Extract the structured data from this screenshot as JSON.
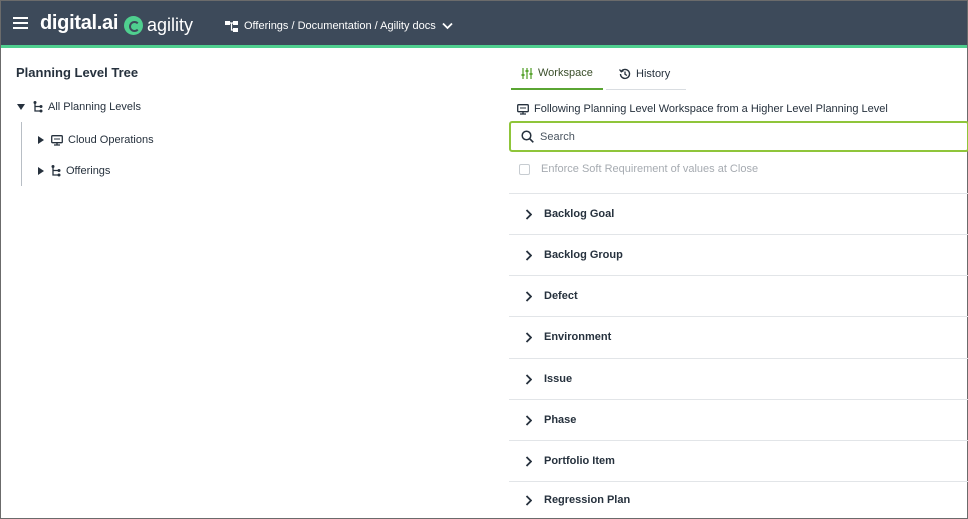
{
  "header": {
    "menu_icon": "hamburger-icon",
    "brand_primary": "digital.ai",
    "brand_product": "agility",
    "breadcrumb": "Offerings / Documentation / Agility docs",
    "colors": {
      "bar": "#3d4a5a",
      "accent": "#4fcf8f"
    }
  },
  "tree": {
    "title": "Planning Level Tree",
    "root": {
      "label": "All Planning Levels",
      "expanded": true,
      "icon": "hierarchy-icon"
    },
    "children": [
      {
        "label": "Cloud Operations",
        "icon": "workspace-icon"
      },
      {
        "label": "Offerings",
        "icon": "hierarchy-icon"
      }
    ]
  },
  "right": {
    "tabs": [
      {
        "label": "Workspace",
        "icon": "sliders-icon",
        "active": true
      },
      {
        "label": "History",
        "icon": "history-icon",
        "active": false
      }
    ],
    "following_text": "Following Planning Level Workspace from a Higher Level Planning Level",
    "search": {
      "placeholder": "Search",
      "value": ""
    },
    "enforce_label": "Enforce Soft Requirement of values at Close",
    "enforce_checked": false,
    "sections": [
      "Backlog Goal",
      "Backlog Group",
      "Defect",
      "Environment",
      "Issue",
      "Phase",
      "Portfolio Item",
      "Regression Plan"
    ],
    "accent_color": "#8fc53a"
  }
}
